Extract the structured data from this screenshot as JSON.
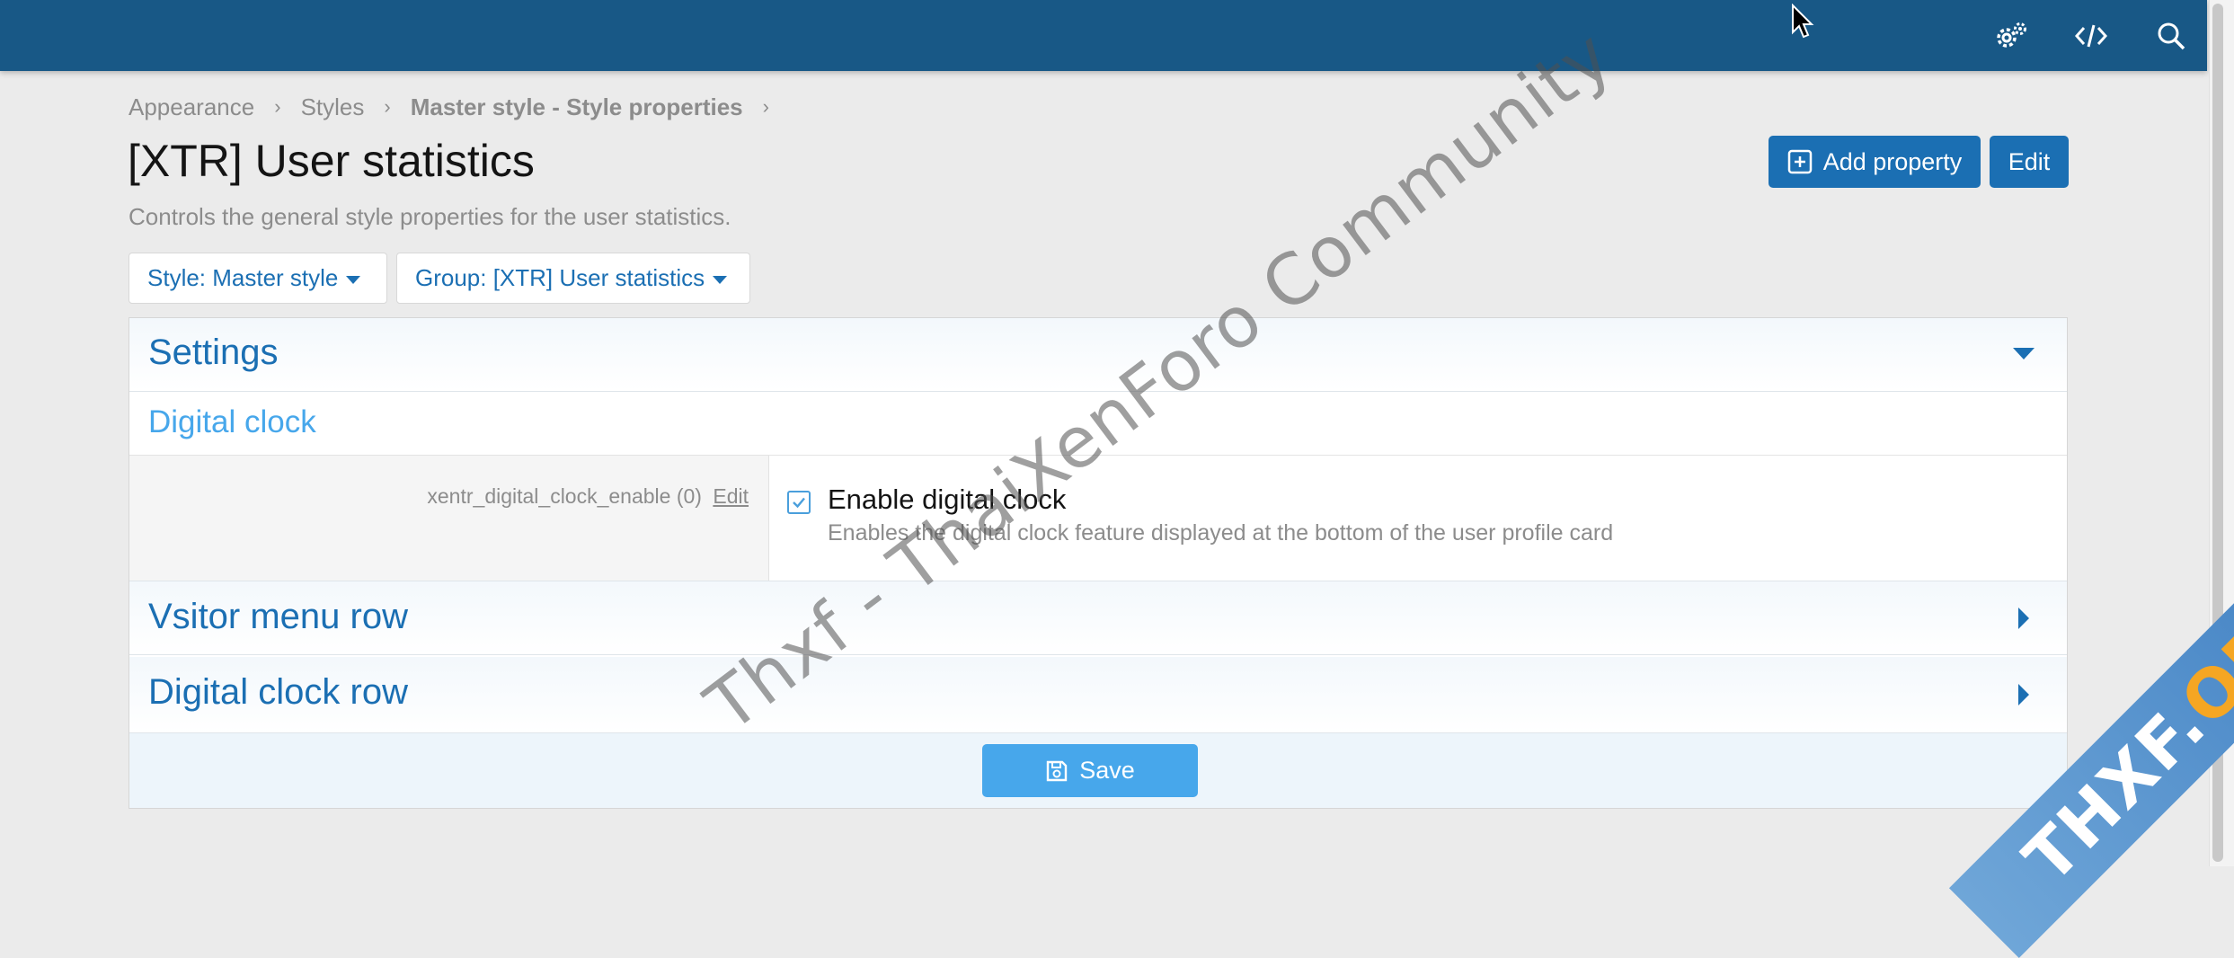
{
  "topbar": {
    "icons": [
      "settings-gear-icon",
      "code-icon",
      "search-icon"
    ]
  },
  "breadcrumb": {
    "items": [
      "Appearance",
      "Styles",
      "Master style - Style properties"
    ]
  },
  "page": {
    "title": "[XTR] User statistics",
    "description": "Controls the general style properties for the user statistics.",
    "add_property_label": "Add property",
    "edit_label": "Edit"
  },
  "filters": {
    "style_label": "Style: Master style",
    "group_label": "Group: [XTR] User statistics"
  },
  "sections": {
    "settings": {
      "title": "Settings",
      "expanded": true,
      "subheader": "Digital clock",
      "property": {
        "name": "xentr_digital_clock_enable (0)",
        "edit_link": "Edit",
        "checked": true,
        "label": "Enable digital clock",
        "hint": "Enables the digital clock feature displayed at the bottom of the user profile card"
      }
    },
    "visitor_menu": {
      "title": "Vsitor menu row",
      "expanded": false
    },
    "digital_clock_row": {
      "title": "Digital clock row",
      "expanded": false
    }
  },
  "footer": {
    "save_label": "Save"
  },
  "watermark": {
    "text": "Thxf - ThaiXenForo Community",
    "ribbon_main": "THXF.",
    "ribbon_org": "ORG"
  },
  "colors": {
    "topbar": "#185886",
    "accent": "#1b6fb3",
    "light_accent": "#47a7eb",
    "ribbon_orange": "#f5a623"
  }
}
